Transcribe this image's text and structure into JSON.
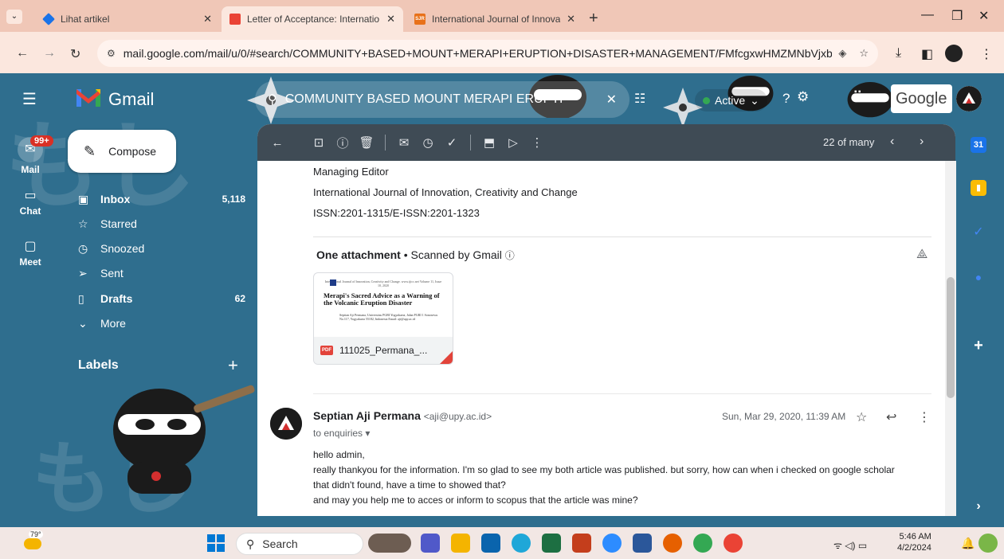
{
  "browser": {
    "tabs": [
      {
        "title": "Lihat artikel",
        "favicon_color": "#1a73e8"
      },
      {
        "title": "Letter of Acceptance: Internatio",
        "favicon_color": "#ea4335",
        "active": true
      },
      {
        "title": "International Journal of Innovat",
        "favicon_color": "#e8711a",
        "favicon_text": "SJR"
      }
    ],
    "url": "mail.google.com/mail/u/0/#search/COMMUNITY+BASED+MOUNT+MERAPI+ERUPTION+DISASTER+MANAGEMENT/FMfcgxwHMZMNbVjxbBt..."
  },
  "gmail": {
    "app_name": "Gmail",
    "search_query": "COMMUNITY BASED MOUNT MERAPI ERUPTI",
    "status": "Active",
    "google_label": "Google",
    "rail": [
      {
        "label": "Mail",
        "badge": "99+"
      },
      {
        "label": "Chat"
      },
      {
        "label": "Meet"
      }
    ],
    "compose_label": "Compose",
    "nav": [
      {
        "label": "Inbox",
        "count": "5,118"
      },
      {
        "label": "Starred",
        "count": ""
      },
      {
        "label": "Snoozed",
        "count": ""
      },
      {
        "label": "Sent",
        "count": ""
      },
      {
        "label": "Drafts",
        "count": "62"
      },
      {
        "label": "More",
        "count": ""
      }
    ],
    "labels_title": "Labels",
    "pager_text": "22 of many"
  },
  "message": {
    "signature": [
      "Managing Editor",
      "International Journal of Innovation, Creativity and  Change",
      "ISSN:2201-1315/E-ISSN:2201-1323"
    ],
    "attachment_count": "One attachment",
    "scanned": "Scanned by Gmail",
    "attachment": {
      "filename": "111025_Permana_...",
      "journal_header": "International Journal of Innovation, Creativity and Change. www.ijicc.net Volume 11, Issue 10, 2020",
      "title": "Merapi's Sacred Advice as a Warning of the Volcanic Eruption Disaster",
      "authors": "Septian Aji Permana, Universitas PGRI Yogyakarta, Jalan PGRI 1 Sonosewu No.117, Yogyakarta 55182, Indonesia Email: aji@upy.ac.id"
    },
    "reply": {
      "sender_name": "Septian Aji Permana",
      "sender_email": "<aji@upy.ac.id>",
      "to": "to enquiries",
      "date": "Sun, Mar 29, 2020, 11:39 AM",
      "body": [
        "hello admin,",
        "really thankyou for the information. I'm so glad to see my both article was published. but sorry, how can when i checked on google scholar",
        "that didn't found, have a time to showed that?",
        "and may you help me to acces or inform to scopus that the article was mine?"
      ]
    }
  },
  "taskbar": {
    "weather": "79°",
    "search_label": "Search",
    "time": "5:46 AM",
    "date": "4/2/2024"
  }
}
